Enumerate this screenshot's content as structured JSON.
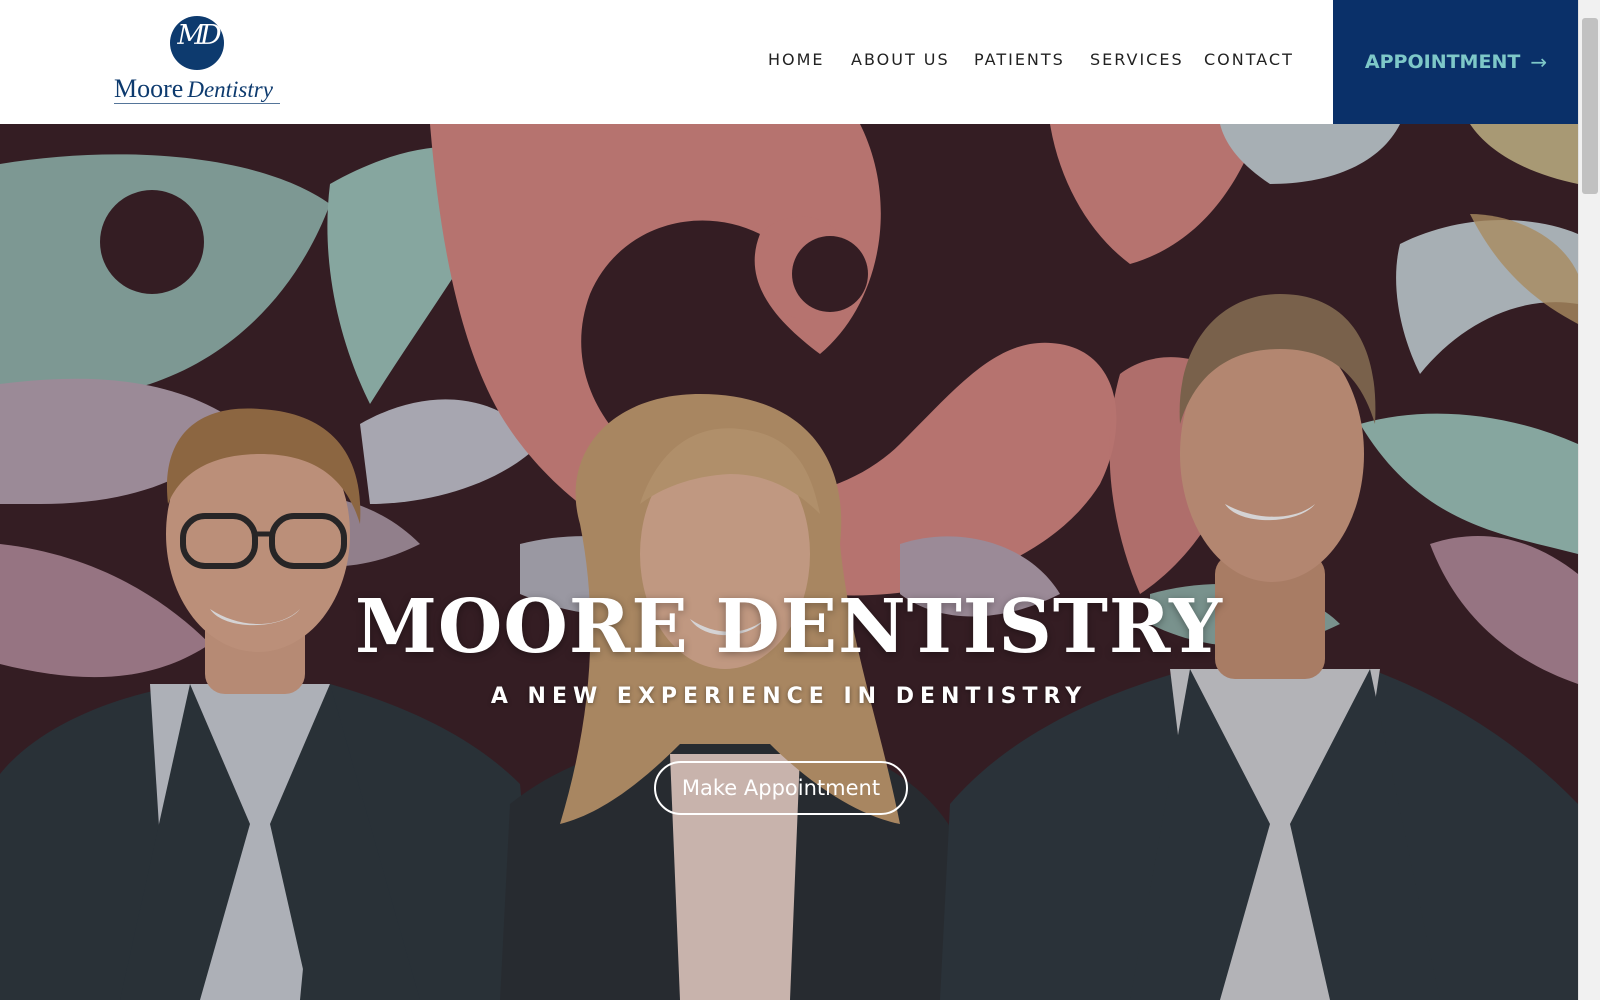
{
  "logo": {
    "monogram": "MD",
    "name_main": "Moore",
    "name_script": "Dentistry"
  },
  "nav": {
    "items": [
      "HOME",
      "ABOUT US",
      "PATIENTS",
      "SERVICES",
      "CONTACT"
    ]
  },
  "appointment_button": {
    "label": "APPOINTMENT",
    "icon": "arrow-right-icon",
    "arrow": "→"
  },
  "hero": {
    "title": "MOORE DENTISTRY",
    "subtitle": "A NEW EXPERIENCE IN DENTISTRY",
    "cta_label": "Make Appointment"
  },
  "colors": {
    "brand_navy": "#0a3069",
    "accent_teal": "#7ec8c8",
    "mural_pink": "#d98a84",
    "mural_maroon": "#3b2228",
    "mural_mint": "#9fc9bf"
  }
}
